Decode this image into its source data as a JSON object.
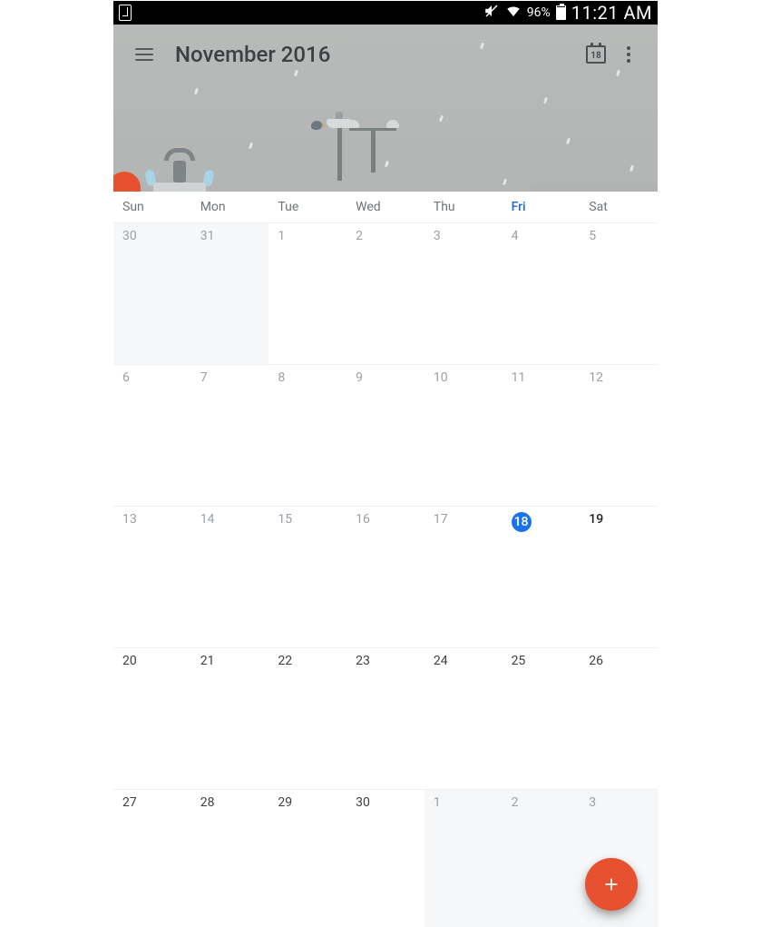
{
  "statusbar": {
    "battery_pct": "96%",
    "clock": "11:21 AM"
  },
  "header": {
    "title": "November 2016",
    "today_badge": "18"
  },
  "calendar": {
    "day_headers": [
      "Sun",
      "Mon",
      "Tue",
      "Wed",
      "Thu",
      "Fri",
      "Sat"
    ],
    "today_column_index": 5,
    "weeks": [
      [
        {
          "d": "30",
          "out": true
        },
        {
          "d": "31",
          "out": true
        },
        {
          "d": "1",
          "dim": true
        },
        {
          "d": "2",
          "dim": true
        },
        {
          "d": "3",
          "dim": true
        },
        {
          "d": "4",
          "dim": true
        },
        {
          "d": "5",
          "dim": true
        }
      ],
      [
        {
          "d": "6",
          "dim": true
        },
        {
          "d": "7",
          "dim": true
        },
        {
          "d": "8",
          "dim": true
        },
        {
          "d": "9",
          "dim": true
        },
        {
          "d": "10",
          "dim": true
        },
        {
          "d": "11",
          "dim": true
        },
        {
          "d": "12",
          "dim": true
        }
      ],
      [
        {
          "d": "13",
          "dim": true
        },
        {
          "d": "14",
          "dim": true
        },
        {
          "d": "15",
          "dim": true
        },
        {
          "d": "16",
          "dim": true
        },
        {
          "d": "17",
          "dim": true
        },
        {
          "d": "18",
          "today": true
        },
        {
          "d": "19",
          "bold": true
        }
      ],
      [
        {
          "d": "20"
        },
        {
          "d": "21"
        },
        {
          "d": "22"
        },
        {
          "d": "23"
        },
        {
          "d": "24"
        },
        {
          "d": "25"
        },
        {
          "d": "26"
        }
      ],
      [
        {
          "d": "27"
        },
        {
          "d": "28"
        },
        {
          "d": "29"
        },
        {
          "d": "30"
        },
        {
          "d": "1",
          "out": true
        },
        {
          "d": "2",
          "out": true
        },
        {
          "d": "3",
          "out": true
        }
      ]
    ]
  },
  "colors": {
    "accent": "#e8512f",
    "today": "#1a73e8"
  }
}
